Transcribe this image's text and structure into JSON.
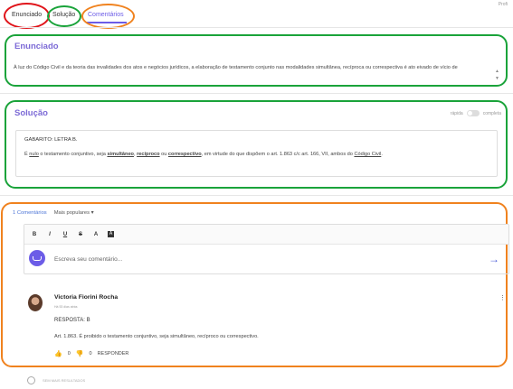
{
  "tabs": [
    {
      "label": "Enunciado"
    },
    {
      "label": "Solução"
    },
    {
      "label": "Comentários"
    }
  ],
  "prof_label": "Profi",
  "enunciado": {
    "title": "Enunciado",
    "text": "À luz do Código Civil e da teoria das invalidades dos atos e negócios jurídicos, a elaboração de testamento conjunto nas modalidades simultânea, recíproca ou correspectiva é ato eivado de vício de"
  },
  "solucao": {
    "title": "Solução",
    "toggle_left": "rápida",
    "toggle_right": "completa",
    "gabarito": "GABARITO: LETRA B.",
    "text_parts": [
      "É ",
      "nulo",
      " o testamento conjuntivo, seja ",
      "simultâneo",
      ", ",
      "recíproco",
      " ou ",
      "correspectivo",
      ", em virtude do que dispõem o art. 1.863 c/c art. 166, VII, ambos do ",
      "Código Civil",
      "."
    ]
  },
  "comentarios": {
    "count": "1 Comentários",
    "sort": "Mais populares ▾",
    "toolbar": [
      "B",
      "I",
      "U",
      "S",
      "A",
      "A"
    ],
    "placeholder": "Escreva seu comentário...",
    "comment": {
      "author": "Victoria Fiorini Rocha",
      "time": "Há 53 dias atrás",
      "resposta": "RESPOSTA: B",
      "text": "Art. 1.863. É proibido o testamento conjuntivo, seja simultâneo, recíproco ou correspectivo.",
      "likes": "0",
      "dislikes": "0",
      "reply": "RESPONDER"
    },
    "more": "SEM MAIS RESULTADOS"
  },
  "colors": {
    "accent": "#6c5ce7",
    "highlight_red": "#e0141a",
    "highlight_green": "#1aa33a",
    "highlight_orange": "#f0821e"
  }
}
